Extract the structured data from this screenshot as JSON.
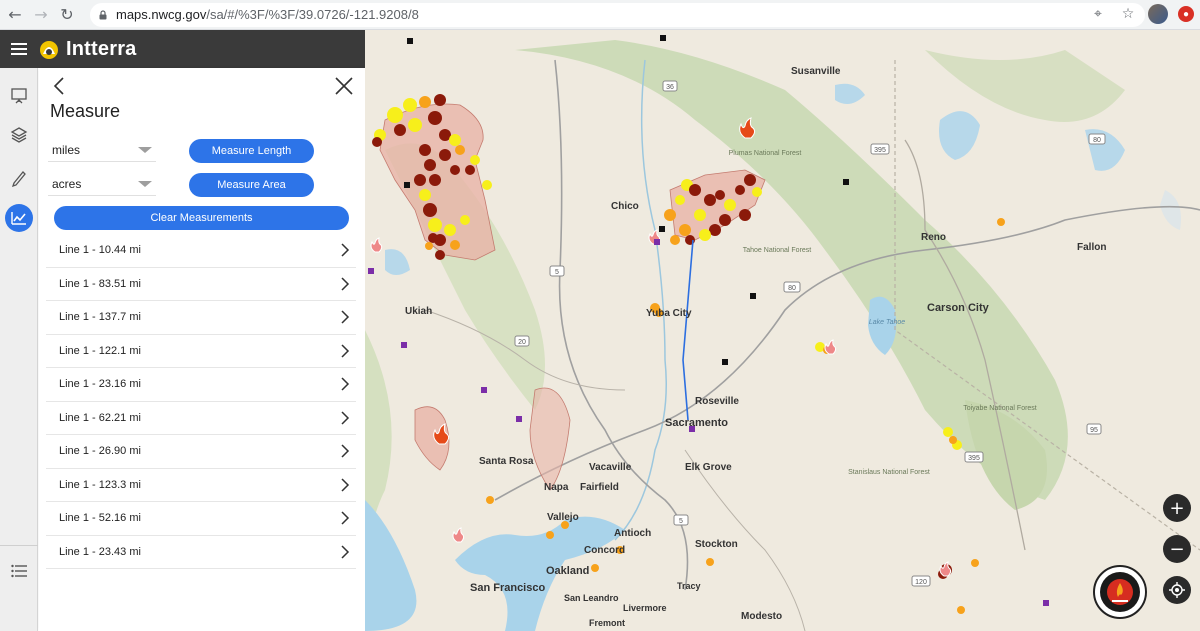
{
  "browser": {
    "url_host": "maps.nwcg.gov",
    "url_path": "/sa/#/%3F/%3F/39.0726/-121.9208/8"
  },
  "app": {
    "brand": "Intterra"
  },
  "panel": {
    "title": "Measure",
    "length_unit": "miles",
    "area_unit": "acres",
    "measure_length_label": "Measure Length",
    "measure_area_label": "Measure Area",
    "clear_label": "Clear Measurements",
    "measurements": [
      "Line 1 - 10.44 mi",
      "Line 1 - 83.51 mi",
      "Line 1 - 137.7 mi",
      "Line 1 - 122.1 mi",
      "Line 1 - 23.16 mi",
      "Line 1 - 62.21 mi",
      "Line 1 - 26.90 mi",
      "Line 1 - 123.3 mi",
      "Line 1 - 52.16 mi",
      "Line 1 - 23.43 mi"
    ]
  },
  "map": {
    "places": {
      "susanville": "Susanville",
      "chico": "Chico",
      "reno": "Reno",
      "fallon": "Fallon",
      "tahoe_nf": "Tahoe National Forest",
      "plumas_nf": "Plumas National Forest",
      "ukiah": "Ukiah",
      "yuba_city": "Yuba City",
      "carson_city": "Carson City",
      "lake_tahoe": "Lake Tahoe",
      "roseville": "Roseville",
      "sacramento": "Sacramento",
      "toiyabe_nf": "Toiyabe National Forest",
      "santa_rosa": "Santa Rosa",
      "vacaville": "Vacaville",
      "elk_grove": "Elk Grove",
      "napa": "Napa",
      "fairfield": "Fairfield",
      "stanislaus_nf": "Stanislaus National Forest",
      "vallejo": "Vallejo",
      "antioch": "Antioch",
      "concord": "Concord",
      "stockton": "Stockton",
      "oakland": "Oakland",
      "san_francisco": "San Francisco",
      "san_leandro": "San Leandro",
      "tracy": "Tracy",
      "livermore": "Livermore",
      "modesto": "Modesto",
      "fremont": "Fremont"
    },
    "highways": {
      "i5a": "5",
      "i5b": "5",
      "i80a": "80",
      "i80b": "80",
      "us395a": "395",
      "us395b": "395",
      "sr20": "20",
      "sr95": "95",
      "sr120": "120",
      "sr36": "36"
    },
    "colors": {
      "water": "#a9d3ea",
      "land": "#efeadf",
      "forest": "#cddbb8",
      "fire_perimeter": "#e8b4a8",
      "fire_red": "#8b1a0a",
      "fire_orange": "#f7a21b",
      "fire_yellow": "#f7ef1b",
      "measure_line": "#2d6fe0",
      "accent": "#2d74e8"
    }
  }
}
